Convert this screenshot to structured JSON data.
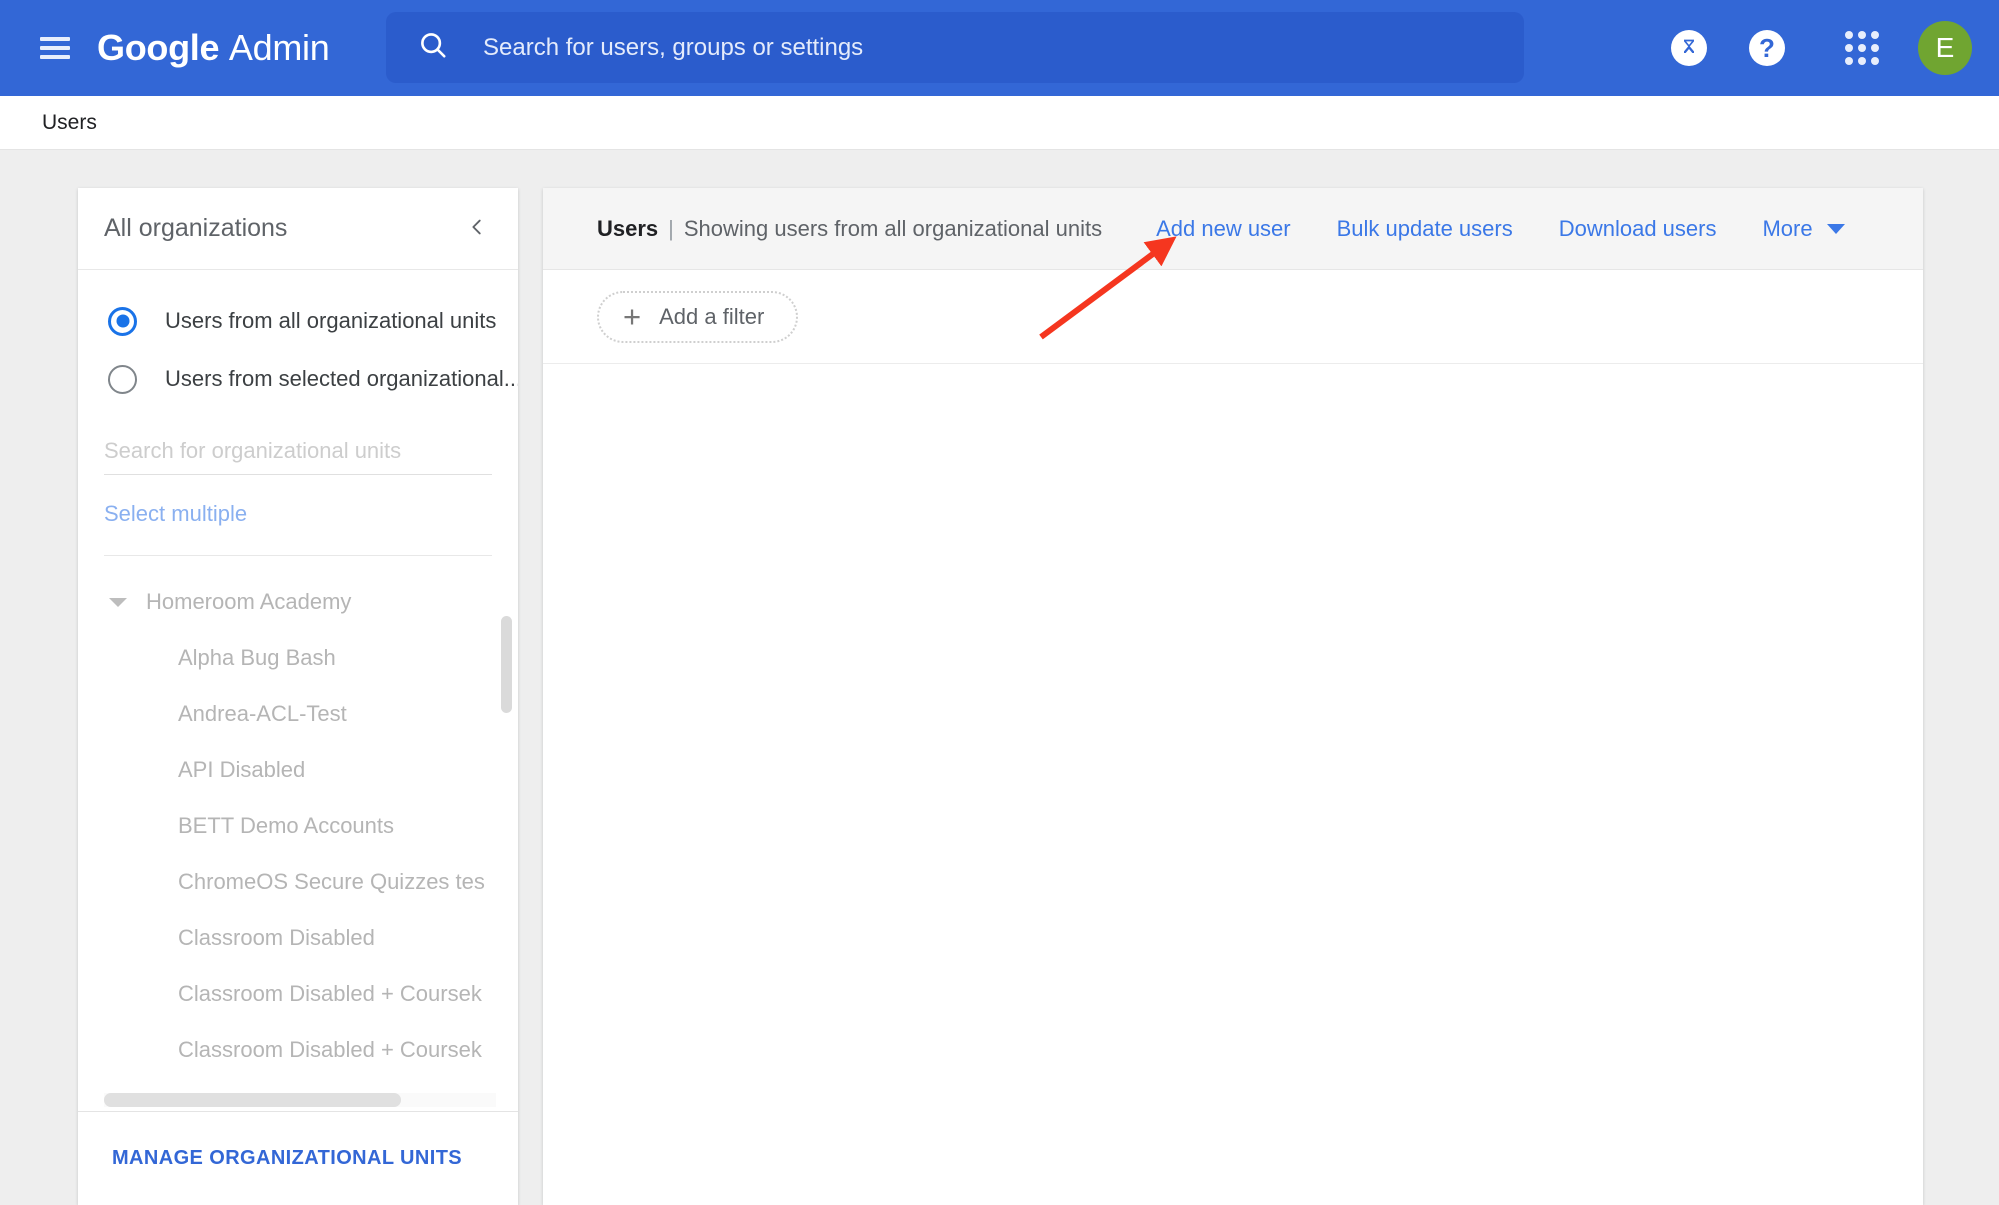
{
  "topbar": {
    "menu_icon": "hamburger-menu-icon",
    "brand_google": "Google",
    "brand_admin": "Admin",
    "search": {
      "icon": "search-icon",
      "value": "",
      "placeholder": "Search for users, groups or settings"
    },
    "hourglass_label": "⌛",
    "help_label": "?",
    "apps_icon": "apps-grid-icon",
    "avatar_initial": "E",
    "colors": {
      "bar": "#3367d6",
      "search_field": "#2b5ccc",
      "avatar": "#70a531"
    }
  },
  "breadcrumb": {
    "label": "Users"
  },
  "sidebar": {
    "title": "All organizations",
    "collapse_icon": "chevron-left-icon",
    "radios": [
      {
        "label": "Users from all organizational units",
        "selected": true
      },
      {
        "label": "Users from selected organizational...",
        "selected": false
      }
    ],
    "ou_search": {
      "value": "",
      "placeholder": "Search for organizational units"
    },
    "select_multiple_label": "Select multiple",
    "tree": [
      {
        "label": "Homeroom Academy",
        "level": 0,
        "expanded": true
      },
      {
        "label": "Alpha Bug Bash",
        "level": 1
      },
      {
        "label": "Andrea-ACL-Test",
        "level": 1
      },
      {
        "label": "API Disabled",
        "level": 1
      },
      {
        "label": "BETT Demo Accounts",
        "level": 1
      },
      {
        "label": "ChromeOS Secure Quizzes tes",
        "level": 1
      },
      {
        "label": "Classroom Disabled",
        "level": 1
      },
      {
        "label": "Classroom Disabled + Coursek",
        "level": 1
      },
      {
        "label": "Classroom Disabled + Coursek",
        "level": 1
      }
    ],
    "manage_button": "MANAGE ORGANIZATIONAL UNITS"
  },
  "main": {
    "header": {
      "title": "Users",
      "separator": "|",
      "subtitle": "Showing users from all organizational units",
      "actions": [
        {
          "label": "Add new user"
        },
        {
          "label": "Bulk update users"
        },
        {
          "label": "Download users"
        }
      ],
      "more_label": "More",
      "more_icon": "chevron-down-icon"
    },
    "filter": {
      "add_icon": "plus-icon",
      "label": "Add a filter"
    }
  },
  "annotation": {
    "type": "arrow",
    "color": "#f5361f",
    "points_to": "Add new user"
  }
}
